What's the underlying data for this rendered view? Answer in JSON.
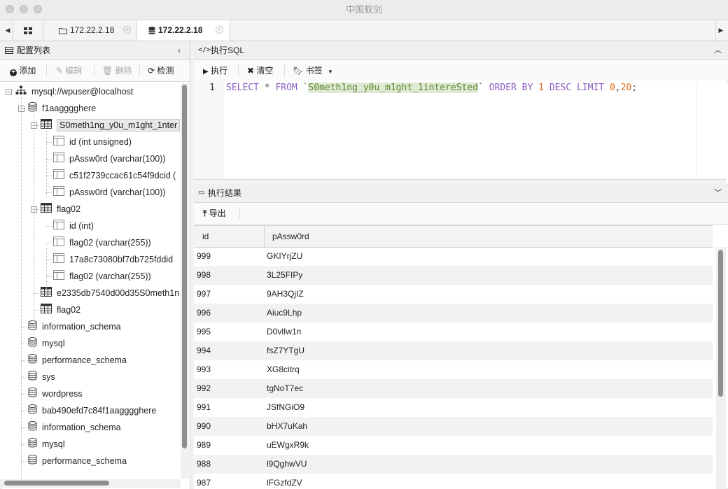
{
  "window": {
    "title": "中国蚁剑"
  },
  "tabs": [
    {
      "label": "172.22.2.18",
      "icon": "folder-icon",
      "active": false
    },
    {
      "label": "172.22.2.18",
      "icon": "database-icon",
      "active": true
    }
  ],
  "left_panel": {
    "title": "配置列表",
    "toolbar": {
      "add": "添加",
      "edit": "编辑",
      "delete": "删除",
      "check": "检测"
    },
    "tree": [
      {
        "label": "mysql://wpuser@localhost",
        "type": "conn",
        "level": 0
      },
      {
        "label": "f1aagggghere",
        "type": "db",
        "level": 1
      },
      {
        "label": "S0meth1ng_y0u_m1ght_1nter",
        "type": "table",
        "level": 2,
        "selected": true
      },
      {
        "label": "id (int unsigned)",
        "type": "col",
        "level": 3
      },
      {
        "label": "pAssw0rd (varchar(100))",
        "type": "col",
        "level": 3
      },
      {
        "label": "c51f2739ccac61c54f9dcid (",
        "type": "col",
        "level": 3
      },
      {
        "label": "pAssw0rd (varchar(100))",
        "type": "col",
        "level": 3
      },
      {
        "label": "flag02",
        "type": "table",
        "level": 2
      },
      {
        "label": "id (int)",
        "type": "col",
        "level": 3
      },
      {
        "label": "flag02 (varchar(255))",
        "type": "col",
        "level": 3
      },
      {
        "label": "17a8c73080bf7db725fddid",
        "type": "col",
        "level": 3
      },
      {
        "label": "flag02 (varchar(255))",
        "type": "col",
        "level": 3
      },
      {
        "label": "e2335db7540d00d35S0meth1n",
        "type": "table",
        "level": 2
      },
      {
        "label": "flag02",
        "type": "table",
        "level": 2
      },
      {
        "label": "information_schema",
        "type": "db",
        "level": 1
      },
      {
        "label": "mysql",
        "type": "db",
        "level": 1
      },
      {
        "label": "performance_schema",
        "type": "db",
        "level": 1
      },
      {
        "label": "sys",
        "type": "db",
        "level": 1
      },
      {
        "label": "wordpress",
        "type": "db",
        "level": 1
      },
      {
        "label": "bab490efd7c84f1aagggghere",
        "type": "db",
        "level": 1
      },
      {
        "label": "information_schema",
        "type": "db",
        "level": 1
      },
      {
        "label": "mysql",
        "type": "db",
        "level": 1
      },
      {
        "label": "performance_schema",
        "type": "db",
        "level": 1
      }
    ]
  },
  "sql_panel": {
    "title": "执行SQL",
    "toolbar": {
      "run": "执行",
      "clear": "清空",
      "bookmark": "书签"
    },
    "line_number": "1",
    "query": {
      "select": "SELECT",
      "star": "*",
      "from": "FROM",
      "tick_open": "`",
      "table": "S0meth1ng_y0u_m1ght_1intereSted",
      "tick_close": "`",
      "order": "ORDER BY",
      "order_col": "1",
      "desc": "DESC",
      "limit": "LIMIT",
      "offset": "0",
      "comma": ",",
      "count": "20",
      "semi": ";"
    }
  },
  "result_panel": {
    "title": "执行结果",
    "export": "导出",
    "columns": [
      "id",
      "pAssw0rd"
    ],
    "rows": [
      [
        "999",
        "GKIYrjZU"
      ],
      [
        "998",
        "3L25FIPy"
      ],
      [
        "997",
        "9AH3QjIZ"
      ],
      [
        "996",
        "Aiuc9Lhp"
      ],
      [
        "995",
        "D0vlIw1n"
      ],
      [
        "994",
        "fsZ7YTgU"
      ],
      [
        "993",
        "XG8citrq"
      ],
      [
        "992",
        "tgNoT7ec"
      ],
      [
        "991",
        "JSfNGiO9"
      ],
      [
        "990",
        "bHX7uKah"
      ],
      [
        "989",
        "uEWgxR9k"
      ],
      [
        "988",
        "l9QghwVU"
      ],
      [
        "987",
        "lFGzfdZV"
      ]
    ]
  }
}
